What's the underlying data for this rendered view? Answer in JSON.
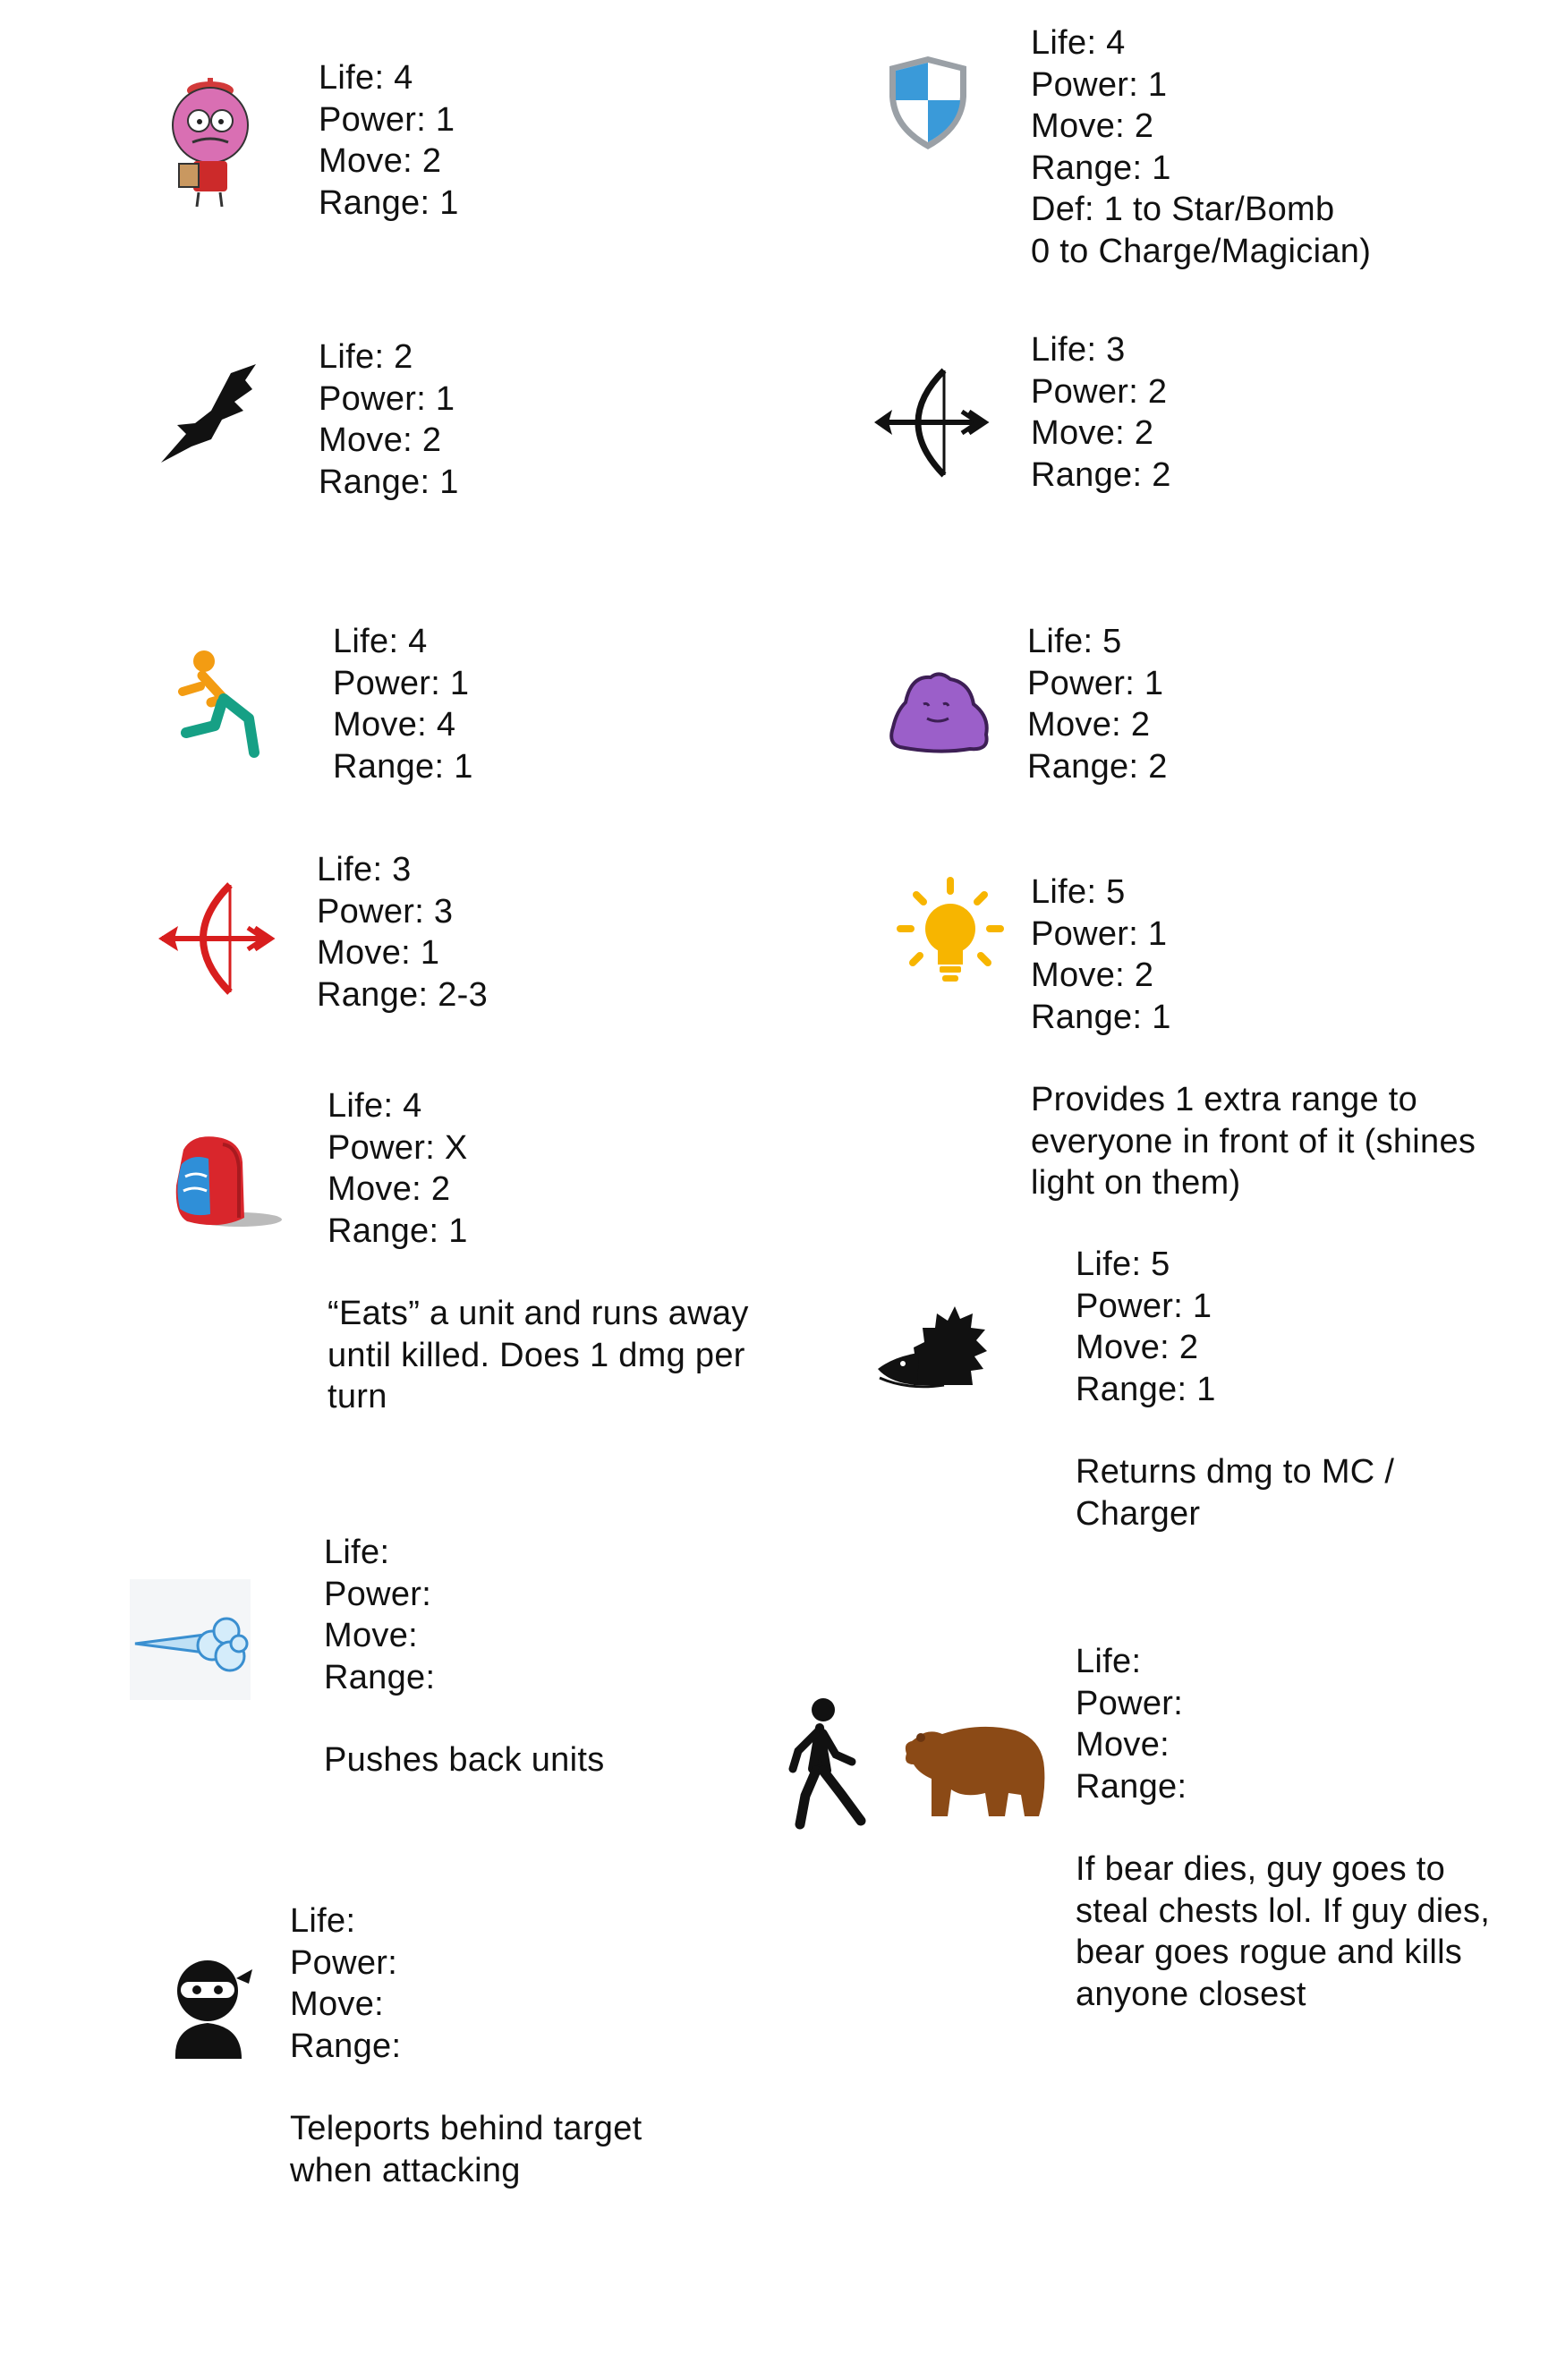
{
  "units": [
    {
      "id": "benson",
      "icon": "cartoon-referee-icon",
      "lines": [
        "Life: 4",
        "Power: 1",
        "Move: 2",
        "Range: 1"
      ],
      "description": []
    },
    {
      "id": "shield",
      "icon": "shield-icon",
      "lines": [
        "Life: 4",
        "Power: 1",
        "Move: 2",
        "Range: 1",
        "Def: 1 to Star/Bomb",
        "0 to Charge/Magician)"
      ],
      "description": []
    },
    {
      "id": "eagle",
      "icon": "eagle-icon",
      "lines": [
        "Life: 2",
        "Power: 1",
        "Move: 2",
        "Range: 1"
      ],
      "description": []
    },
    {
      "id": "archer",
      "icon": "bow-arrow-icon",
      "lines": [
        "Life: 3",
        "Power: 2",
        "Move: 2",
        "Range: 2"
      ],
      "description": []
    },
    {
      "id": "runner",
      "icon": "running-person-icon",
      "lines": [
        "Life: 4",
        "Power: 1",
        "Move: 4",
        "Range: 1"
      ],
      "description": []
    },
    {
      "id": "blob",
      "icon": "purple-blob-icon",
      "lines": [
        "Life: 5",
        "Power: 1",
        "Move: 2",
        "Range: 2"
      ],
      "description": []
    },
    {
      "id": "red-archer",
      "icon": "red-bow-arrow-icon",
      "lines": [
        "Life: 3",
        "Power: 3",
        "Move: 1",
        "Range: 2-3"
      ],
      "description": []
    },
    {
      "id": "lightbulb",
      "icon": "lightbulb-icon",
      "lines": [
        "Life: 5",
        "Power: 1",
        "Move: 2",
        "Range: 1"
      ],
      "description": [
        "Provides 1 extra range to",
        "everyone in front of it (shines",
        "light on them)"
      ]
    },
    {
      "id": "backpack",
      "icon": "backpack-icon",
      "lines": [
        "Life: 4",
        "Power: X",
        "Move: 2",
        "Range: 1"
      ],
      "description": [
        "“Eats” a unit and runs away",
        "until killed.  Does 1 dmg per",
        "turn"
      ]
    },
    {
      "id": "hedgehog",
      "icon": "hedgehog-icon",
      "lines": [
        "Life: 5",
        "Power: 1",
        "Move: 2",
        "Range: 1"
      ],
      "description": [
        "Returns dmg to MC /",
        "Charger"
      ]
    },
    {
      "id": "wind",
      "icon": "wind-gust-icon",
      "lines": [
        "Life:",
        "Power:",
        "Move:",
        "Range:"
      ],
      "description": [
        "Pushes back units"
      ]
    },
    {
      "id": "guy-bear",
      "icon": "walking-person-and-bear-icon",
      "lines": [
        "Life:",
        "Power:",
        "Move:",
        "Range:"
      ],
      "description": [
        "If bear dies, guy goes to",
        "steal chests lol.  If guy dies,",
        "bear goes rogue and kills",
        "anyone closest"
      ]
    },
    {
      "id": "ninja",
      "icon": "ninja-icon",
      "lines": [
        "Life:",
        "Power:",
        "Move:",
        "Range:"
      ],
      "description": [
        "Teleports behind target",
        "when attacking"
      ]
    }
  ]
}
